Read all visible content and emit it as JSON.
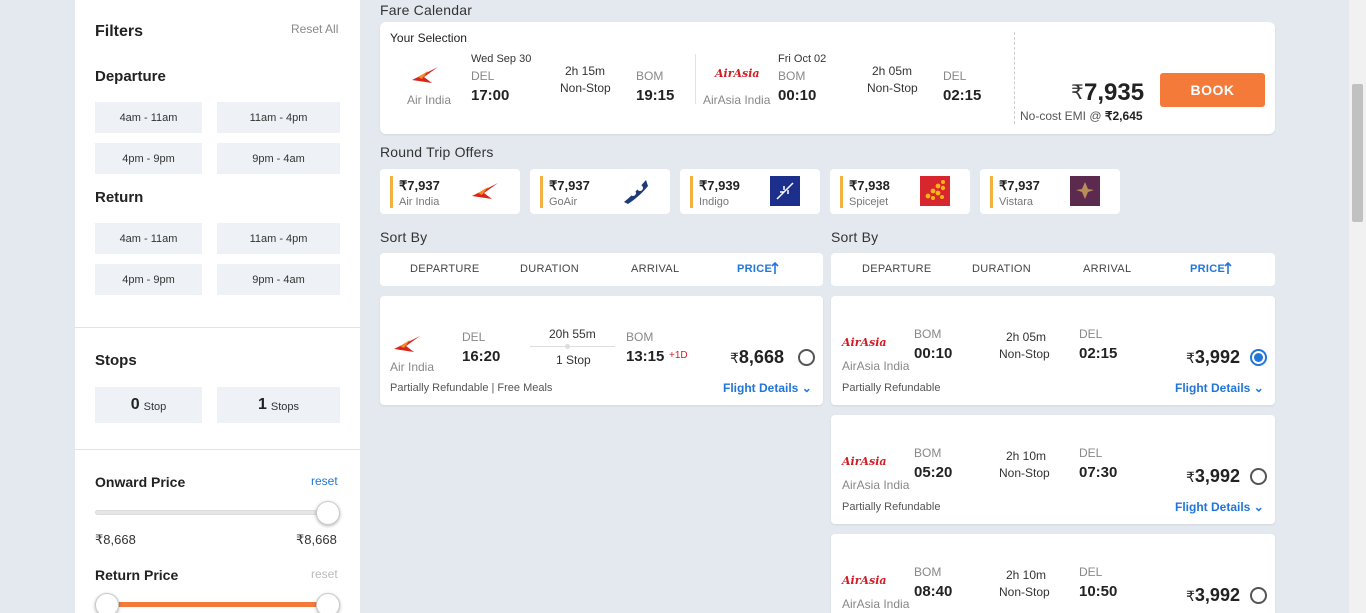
{
  "filters": {
    "title": "Filters",
    "reset_all": "Reset All",
    "departure": {
      "heading": "Departure",
      "slots": [
        "4am - 11am",
        "11am - 4pm",
        "4pm - 9pm",
        "9pm - 4am"
      ]
    },
    "return": {
      "heading": "Return",
      "slots": [
        "4am - 11am",
        "11am - 4pm",
        "4pm - 9pm",
        "9pm - 4am"
      ]
    },
    "stops": {
      "heading": "Stops",
      "options": [
        {
          "num": "0",
          "label": "Stop"
        },
        {
          "num": "1",
          "label": "Stops"
        }
      ]
    },
    "onward_price": {
      "heading": "Onward Price",
      "reset": "reset",
      "min": "₹8,668",
      "max": "₹8,668"
    },
    "return_price": {
      "heading": "Return Price",
      "reset": "reset"
    }
  },
  "fare_calendar": {
    "title": "Fare Calendar",
    "your_selection": "Your Selection",
    "onward": {
      "airline": "Air India",
      "date": "Wed Sep 30",
      "from_code": "DEL",
      "dep_time": "17:00",
      "duration": "2h 15m",
      "stops": "Non-Stop",
      "to_code": "BOM",
      "arr_time": "19:15"
    },
    "return": {
      "airline": "AirAsia India",
      "logo_text": "AirAsia",
      "date": "Fri Oct 02",
      "from_code": "BOM",
      "dep_time": "00:10",
      "duration": "2h 05m",
      "stops": "Non-Stop",
      "to_code": "DEL",
      "arr_time": "02:15"
    },
    "currency": "₹",
    "total": "7,935",
    "emi_label": "No-cost EMI @ ",
    "emi_value": "₹2,645",
    "book": "BOOK"
  },
  "round_trip": {
    "title": "Round Trip Offers",
    "offers": [
      {
        "price": "₹7,937",
        "airline": "Air India",
        "logo": "air-india"
      },
      {
        "price": "₹7,937",
        "airline": "GoAir",
        "logo": "goair"
      },
      {
        "price": "₹7,939",
        "airline": "Indigo",
        "logo": "indigo"
      },
      {
        "price": "₹7,938",
        "airline": "Spicejet",
        "logo": "spicejet"
      },
      {
        "price": "₹7,937",
        "airline": "Vistara",
        "logo": "vistara"
      }
    ]
  },
  "sort": {
    "title": "Sort By",
    "columns": [
      "DEPARTURE",
      "DURATION",
      "ARRIVAL",
      "PRICE"
    ],
    "active_icon": "arrow-up-icon"
  },
  "onward_flights": [
    {
      "airline": "Air India",
      "from": "DEL",
      "dep": "16:20",
      "duration": "20h 55m",
      "stops": "1 Stop",
      "to": "BOM",
      "arr": "13:15",
      "next_day": "+1D",
      "price": "8,668",
      "note": "Partially Refundable | Free Meals",
      "details": "Flight Details",
      "selected": false
    }
  ],
  "return_flights": [
    {
      "airline": "AirAsia India",
      "logo_text": "AirAsia",
      "from": "BOM",
      "dep": "00:10",
      "duration": "2h 05m",
      "stops": "Non-Stop",
      "to": "DEL",
      "arr": "02:15",
      "price": "3,992",
      "note": "Partially Refundable",
      "details": "Flight Details",
      "selected": true
    },
    {
      "airline": "AirAsia India",
      "logo_text": "AirAsia",
      "from": "BOM",
      "dep": "05:20",
      "duration": "2h 10m",
      "stops": "Non-Stop",
      "to": "DEL",
      "arr": "07:30",
      "price": "3,992",
      "note": "Partially Refundable",
      "details": "Flight Details",
      "selected": false
    },
    {
      "airline": "AirAsia India",
      "logo_text": "AirAsia",
      "from": "BOM",
      "dep": "08:40",
      "duration": "2h 10m",
      "stops": "Non-Stop",
      "to": "DEL",
      "arr": "10:50",
      "price": "3,992",
      "selected": false
    }
  ],
  "colors": {
    "accent": "#2276d8",
    "book": "#f47a3a",
    "offer_bar": "#f5b140",
    "airasia": "#d21c24"
  }
}
